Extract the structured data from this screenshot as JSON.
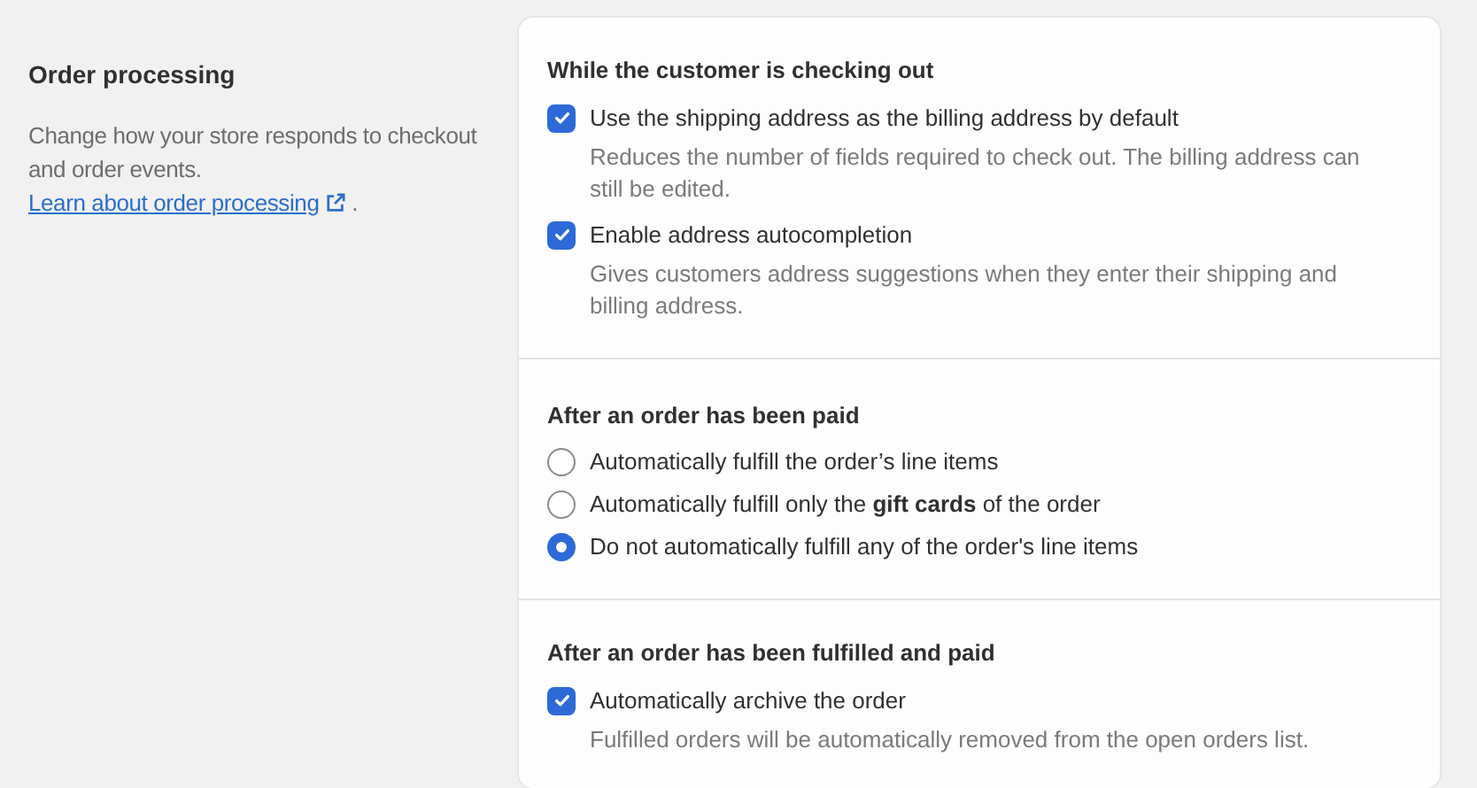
{
  "intro": {
    "title": "Order processing",
    "description": "Change how your store responds to checkout and order events.",
    "link": "Learn about order processing",
    "after_link": "."
  },
  "sections": [
    {
      "title": "While the customer is checking out",
      "options": [
        {
          "kind": "checkbox",
          "label": "Use the shipping address as the billing address by default",
          "help": "Reduces the number of fields required to check out. The billing address can still be edited.",
          "checked": true
        },
        {
          "kind": "checkbox",
          "label": "Enable address autocompletion",
          "help": "Gives customers address suggestions when they enter their shipping and billing address.",
          "checked": true
        }
      ]
    },
    {
      "title": "After an order has been paid",
      "options": [
        {
          "kind": "radio",
          "label": "Automatically fulfill the order’s line items",
          "selected": false
        },
        {
          "kind": "radio",
          "label": "Automatically fulfill only the **gift cards** of the order",
          "selected": false
        },
        {
          "kind": "radio",
          "label": "Do not automatically fulfill any of the order's line items",
          "selected": true
        }
      ]
    },
    {
      "title": "After an order has been fulfilled and paid",
      "options": [
        {
          "kind": "checkbox",
          "label": "Automatically archive the order",
          "help": "Fulfilled orders will be automatically removed from the open orders list.",
          "checked": true
        }
      ]
    }
  ]
}
